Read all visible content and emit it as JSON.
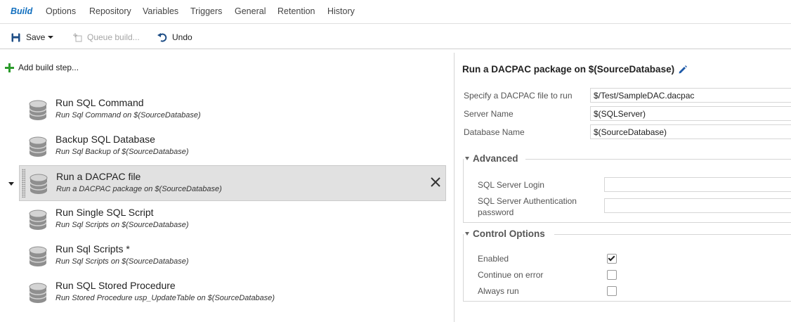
{
  "tabs": [
    "Build",
    "Options",
    "Repository",
    "Variables",
    "Triggers",
    "General",
    "Retention",
    "History"
  ],
  "toolbar": {
    "save": "Save",
    "queue": "Queue build...",
    "undo": "Undo"
  },
  "left": {
    "add_step": "Add build step...",
    "steps": [
      {
        "title": "Run SQL Command",
        "subtitle": "Run Sql Command on $(SourceDatabase)"
      },
      {
        "title": "Backup SQL Database",
        "subtitle": "Run Sql Backup of $(SourceDatabase)"
      },
      {
        "title": "Run a DACPAC file",
        "subtitle": "Run a DACPAC package on $(SourceDatabase)"
      },
      {
        "title": "Run Single SQL Script",
        "subtitle": "Run Sql Scripts on $(SourceDatabase)"
      },
      {
        "title": "Run Sql Scripts *",
        "subtitle": "Run Sql Scripts on $(SourceDatabase)"
      },
      {
        "title": "Run SQL Stored Procedure",
        "subtitle": "Run Stored Procedure usp_UpdateTable on $(SourceDatabase)"
      }
    ]
  },
  "right": {
    "title": "Run a DACPAC package on $(SourceDatabase)",
    "fields": [
      {
        "label": "Specify a DACPAC file to run",
        "value": "$/Test/SampleDAC.dacpac"
      },
      {
        "label": "Server Name",
        "value": "$(SQLServer)"
      },
      {
        "label": "Database Name",
        "value": "$(SourceDatabase)"
      }
    ],
    "advanced": {
      "heading": "Advanced",
      "login_label": "SQL Server Login",
      "login_value": "",
      "password_label_line1": "SQL Server Authentication",
      "password_label_line2": "password",
      "password_value": ""
    },
    "control": {
      "heading": "Control Options",
      "enabled": "Enabled",
      "continue": "Continue on error",
      "always": "Always run"
    }
  },
  "colors": {
    "accent": "#106ebe",
    "add_green": "#2c9b2c",
    "selected_bg": "#e1e1e1"
  }
}
